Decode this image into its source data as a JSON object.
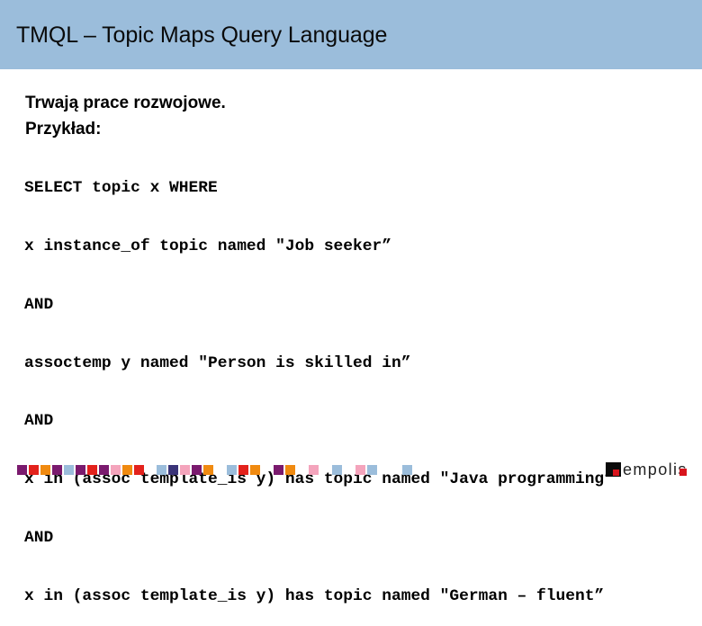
{
  "slide": {
    "title": "TMQL – Topic Maps Query Language",
    "header_color": "#9bbddb"
  },
  "intro": {
    "line1": "Trwają prace rozwojowe.",
    "line2": "Przykład:"
  },
  "code": {
    "lines": [
      "SELECT topic x WHERE",
      "x instance_of topic named \"Job seeker”",
      "AND",
      "assoctemp y named \"Person is skilled in”",
      "AND",
      "x in (assoc template_is y) has topic named \"Java programming”",
      "AND",
      "x in (assoc template_is y) has topic named \"German – fluent”"
    ]
  },
  "footer": {
    "palette": {
      "purple": "#7a1a6e",
      "red": "#e3221c",
      "orange": "#f08a10",
      "lightblue": "#9bbddb",
      "navy": "#3a3478",
      "pink": "#f4a4bc"
    },
    "squares": [
      "purple",
      "red",
      "orange",
      "purple",
      "lightblue",
      "purple",
      "red",
      "purple",
      "pink",
      "orange",
      "red",
      "lightblue",
      "navy",
      "pink",
      "purple",
      "orange",
      "lightblue",
      "red",
      "orange",
      "purple",
      "orange",
      "pink",
      "lightblue",
      "pink",
      "lightblue",
      "lightblue"
    ],
    "logo": {
      "text": "empolis",
      "accent_color": "#d8141c"
    }
  }
}
